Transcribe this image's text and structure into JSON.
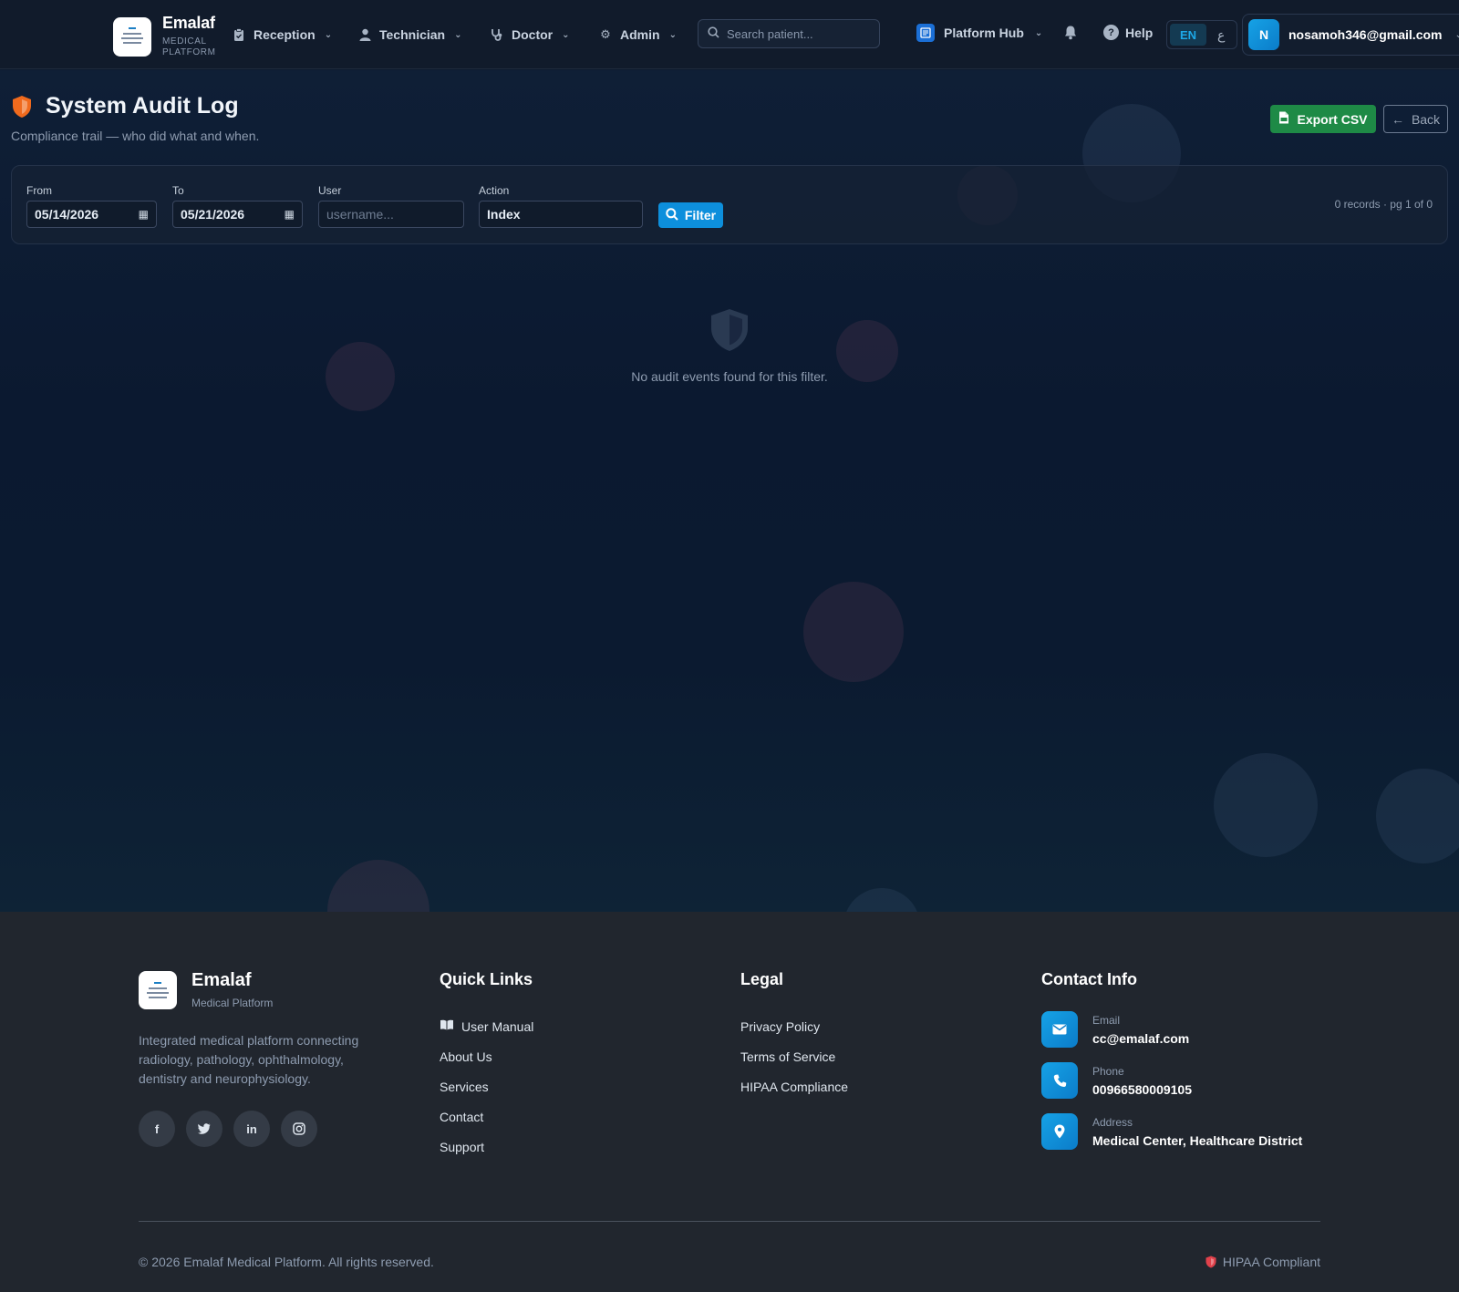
{
  "brand": {
    "name": "Emalaf",
    "tagline_line1": "MEDICAL",
    "tagline_line2": "PLATFORM"
  },
  "nav": {
    "items": [
      {
        "label": "Reception",
        "icon": "clipboard-icon"
      },
      {
        "label": "Technician",
        "icon": "user-icon"
      },
      {
        "label": "Doctor",
        "icon": "stethoscope-icon"
      },
      {
        "label": "Admin",
        "icon": "gear-icon"
      }
    ],
    "search_placeholder": "Search patient...",
    "hub_label": "Platform Hub",
    "help_label": "Help",
    "lang_active": "EN",
    "lang_alt": "ع",
    "user_initial": "N",
    "user_email": "nosamoh346@gmail.com"
  },
  "page": {
    "title": "System Audit Log",
    "subtitle": "Compliance trail — who did what and when.",
    "export_label": "Export CSV",
    "back_label": "Back"
  },
  "filters": {
    "from_label": "From",
    "from_value": "05/14/2026",
    "to_label": "To",
    "to_value": "05/21/2026",
    "user_label": "User",
    "user_placeholder": "username...",
    "action_label": "Action",
    "action_value": "Index",
    "filter_button": "Filter",
    "records_summary": "0 records · pg 1 of 0"
  },
  "empty_state": {
    "message": "No audit events found for this filter."
  },
  "footer": {
    "brand_name": "Emalaf",
    "brand_sub": "Medical Platform",
    "description": "Integrated medical platform connecting radiology, pathology, ophthalmology, dentistry and neurophysiology.",
    "socials": [
      "facebook-icon",
      "twitter-icon",
      "linkedin-icon",
      "instagram-icon"
    ],
    "quick_links_title": "Quick Links",
    "quick_links": [
      "User Manual",
      "About Us",
      "Services",
      "Contact",
      "Support"
    ],
    "legal_title": "Legal",
    "legal_links": [
      "Privacy Policy",
      "Terms of Service",
      "HIPAA Compliance"
    ],
    "contact_title": "Contact Info",
    "contact": [
      {
        "label": "Email",
        "value": "cc@emalaf.com",
        "icon": "envelope-icon"
      },
      {
        "label": "Phone",
        "value": "00966580009105",
        "icon": "phone-icon"
      },
      {
        "label": "Address",
        "value": "Medical Center, Healthcare District",
        "icon": "location-pin-icon"
      }
    ],
    "copyright": "© 2026 Emalaf Medical Platform. All rights reserved.",
    "hipaa_badge": "HIPAA Compliant"
  },
  "colors": {
    "accent": "#0d8fdc",
    "export_green": "#1e8a46",
    "shield_orange": "#f06a1d",
    "hipaa_red": "#e0414b"
  }
}
